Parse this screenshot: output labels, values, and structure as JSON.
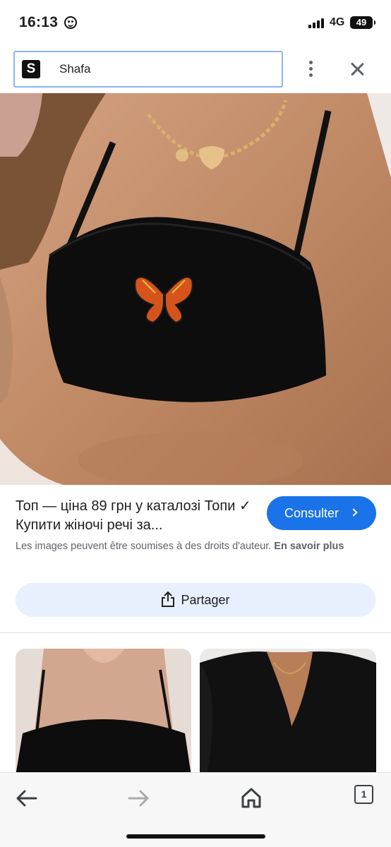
{
  "status_bar": {
    "time": "16:13",
    "network": "4G",
    "battery": "49"
  },
  "top_bar": {
    "site_logo_letter": "S",
    "site_name": "Shafa"
  },
  "result": {
    "title": "Топ — ціна 89 грн у каталозі Топи ✓ Купити жіночі речі за...",
    "consult_label": "Consulter",
    "copyright_text": "Les images peuvent être soumises à des droits d'auteur.",
    "learn_more_label": "En savoir plus",
    "share_label": "Partager"
  },
  "bottom_bar": {
    "tabs_count": "1"
  },
  "colors": {
    "accent": "#1a73e8",
    "share_bg": "#e8f0fe",
    "field_border": "#8ab4f8"
  },
  "icons": [
    "smiley-icon",
    "signal-icon",
    "battery-icon",
    "more-vert-icon",
    "close-icon",
    "chevron-right-icon",
    "share-icon",
    "back-arrow-icon",
    "forward-arrow-icon",
    "home-icon",
    "tabs-icon"
  ]
}
